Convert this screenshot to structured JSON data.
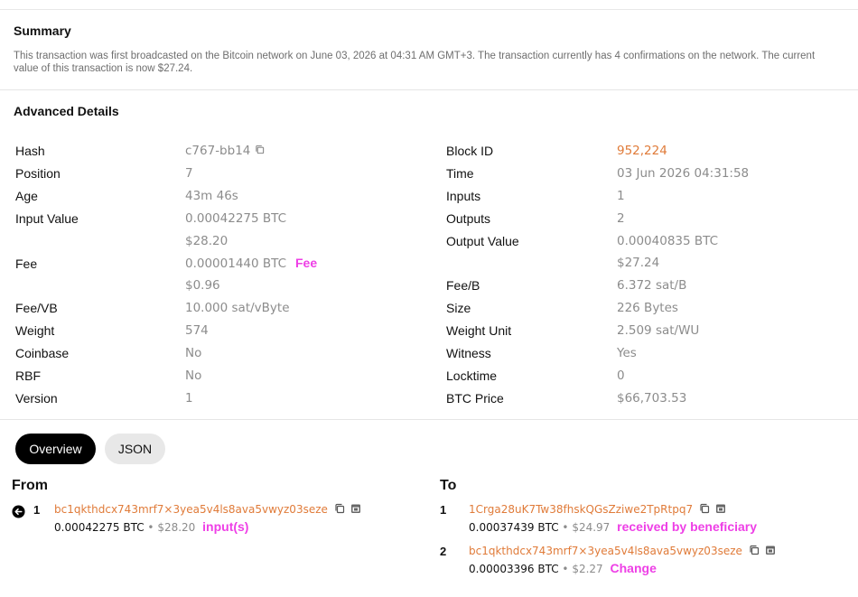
{
  "summary": {
    "title": "Summary",
    "text": "This transaction was first broadcasted on the Bitcoin network on June 03, 2026 at 04:31 AM GMT+3. The transaction currently has 4 confirmations on the network. The current value of this transaction is now $27.24."
  },
  "advanced": {
    "title": "Advanced Details",
    "left": [
      {
        "label": "Hash",
        "value": "c767-bb14"
      },
      {
        "label": "Position",
        "value": "7"
      },
      {
        "label": "Age",
        "value": "43m 46s"
      },
      {
        "label": "Input Value",
        "value": "0.00042275 BTC",
        "value2": "$28.20"
      },
      {
        "label": "Fee",
        "value": "0.00001440 BTC",
        "value2": "$0.96",
        "note": "Fee"
      },
      {
        "label": "Fee/VB",
        "value": "10.000 sat/vByte"
      },
      {
        "label": "Weight",
        "value": "574"
      },
      {
        "label": "Coinbase",
        "value": "No"
      },
      {
        "label": "RBF",
        "value": "No"
      },
      {
        "label": "Version",
        "value": "1"
      }
    ],
    "right": [
      {
        "label": "Block ID",
        "value": "952,224"
      },
      {
        "label": "Time",
        "value": "03 Jun 2026 04:31:58"
      },
      {
        "label": "Inputs",
        "value": "1"
      },
      {
        "label": "Outputs",
        "value": "2"
      },
      {
        "label": "Output Value",
        "value": "0.00040835 BTC",
        "value2": "$27.24"
      },
      {
        "label": "Fee/B",
        "value": "6.372 sat/B"
      },
      {
        "label": "Size",
        "value": "226 Bytes"
      },
      {
        "label": "Weight Unit",
        "value": "2.509 sat/WU"
      },
      {
        "label": "Witness",
        "value": "Yes"
      },
      {
        "label": "Locktime",
        "value": "0"
      },
      {
        "label": "BTC Price",
        "value": "$66,703.53"
      }
    ]
  },
  "tabs": {
    "overview": "Overview",
    "json": "JSON"
  },
  "from": {
    "heading": "From",
    "items": [
      {
        "index": "1",
        "address": "bc1qkthdcx743mrf7×3yea5v4ls8ava5vwyz03seze",
        "btc": "0.00042275 BTC",
        "usd": "$28.20",
        "note": "input(s)"
      }
    ]
  },
  "to": {
    "heading": "To",
    "items": [
      {
        "index": "1",
        "address": "1Crga28uK7Tw38fhskQGsZziwe2TpRtpq7",
        "btc": "0.00037439 BTC",
        "usd": "$24.97",
        "note": "received by beneficiary"
      },
      {
        "index": "2",
        "address": "bc1qkthdcx743mrf7×3yea5v4ls8ava5vwyz03seze",
        "btc": "0.00003396 BTC",
        "usd": "$2.27",
        "note": "Change"
      }
    ]
  },
  "separator": "•",
  "colors": {
    "accent": "#e07b39",
    "annotation": "#ee3fe6"
  }
}
